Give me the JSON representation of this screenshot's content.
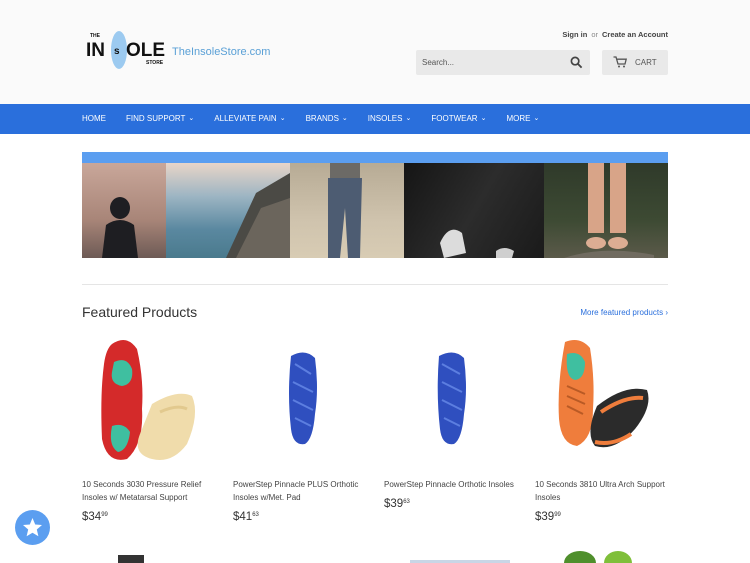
{
  "header": {
    "logo_word": "INSOLE",
    "logo_small_top": "THE",
    "logo_small_bottom": "STORE",
    "logo_site": "TheInsoleStore.com",
    "sign_in": "Sign in",
    "or": "or",
    "create_account": "Create an Account",
    "search_placeholder": "Search...",
    "cart_label": "CART"
  },
  "nav": {
    "items": [
      {
        "label": "HOME",
        "dropdown": false
      },
      {
        "label": "FIND SUPPORT",
        "dropdown": true
      },
      {
        "label": "ALLEVIATE PAIN",
        "dropdown": true
      },
      {
        "label": "BRANDS",
        "dropdown": true
      },
      {
        "label": "INSOLES",
        "dropdown": true
      },
      {
        "label": "FOOTWEAR",
        "dropdown": true
      },
      {
        "label": "MORE",
        "dropdown": true
      }
    ]
  },
  "featured": {
    "title": "Featured Products",
    "more_link": "More featured products ›"
  },
  "products": [
    {
      "name": "10 Seconds 3030 Pressure Relief Insoles w/ Metatarsal Support",
      "price_main": "$34",
      "price_cents": "99"
    },
    {
      "name": "PowerStep Pinnacle PLUS Orthotic Insoles w/Met. Pad",
      "price_main": "$41",
      "price_cents": "63"
    },
    {
      "name": "PowerStep Pinnacle Orthotic Insoles",
      "price_main": "$39",
      "price_cents": "63"
    },
    {
      "name": "10 Seconds 3810 Ultra Arch Support Insoles",
      "price_main": "$39",
      "price_cents": "99"
    }
  ],
  "colors": {
    "nav_bg": "#2a6fdc",
    "hero_bar": "#5b9ef0",
    "link": "#2a6fdc"
  }
}
